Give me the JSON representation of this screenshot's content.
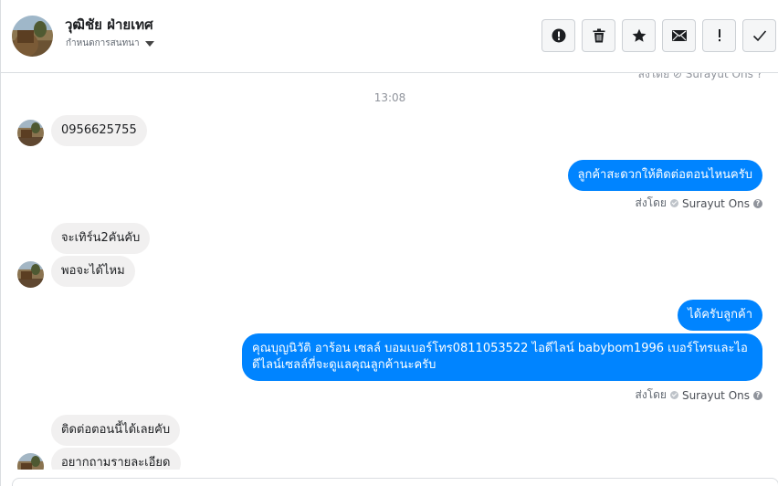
{
  "header": {
    "contact_name": "วุฒิชัย ฝ่ายเทศ",
    "subtitle": "กำหนดการสนทนา",
    "actions": [
      {
        "name": "report-button",
        "icon": "exclamation-circle-icon"
      },
      {
        "name": "delete-button",
        "icon": "trash-icon"
      },
      {
        "name": "star-button",
        "icon": "star-icon"
      },
      {
        "name": "mark-unread-button",
        "icon": "envelope-icon"
      },
      {
        "name": "priority-button",
        "icon": "exclamation-icon"
      },
      {
        "name": "done-button",
        "icon": "checkmark-icon"
      }
    ]
  },
  "conversation": {
    "clipped_top_text": "ส่งโดย ⊘ Surayut Ons ?",
    "timestamp": "13:08",
    "messages": [
      {
        "direction": "incoming",
        "text": "0956625755"
      },
      {
        "direction": "outgoing",
        "text": "ลูกค้าสะดวกให้ติดต่อตอนไหนครับ"
      },
      {
        "direction": "incoming",
        "text": "จะเทิร์น2คันคับ"
      },
      {
        "direction": "incoming",
        "text": "พอจะได้ไหม"
      },
      {
        "direction": "outgoing",
        "text": "ได้ครับลูกค้า"
      },
      {
        "direction": "outgoing",
        "text": "คุณบุญนิวัติ อาร้อน เซลล์ บอมเบอร์โทร0811053522 ไอดีไลน์ babybom1996  เบอร์โทรและไอดีไลน์เซลล์ที่จะดูแลคุณลูกค้านะครับ"
      },
      {
        "direction": "incoming",
        "text": "ติดต่อตอนนี้ได้เลยคับ"
      },
      {
        "direction": "incoming",
        "text": "อยากถามรายละเอียด"
      }
    ],
    "sent_by_label": "ส่งโดย",
    "sender_name": "Surayut Ons"
  },
  "colors": {
    "outgoing_bubble": "#0084ff",
    "incoming_bubble": "#f1f0f0"
  }
}
